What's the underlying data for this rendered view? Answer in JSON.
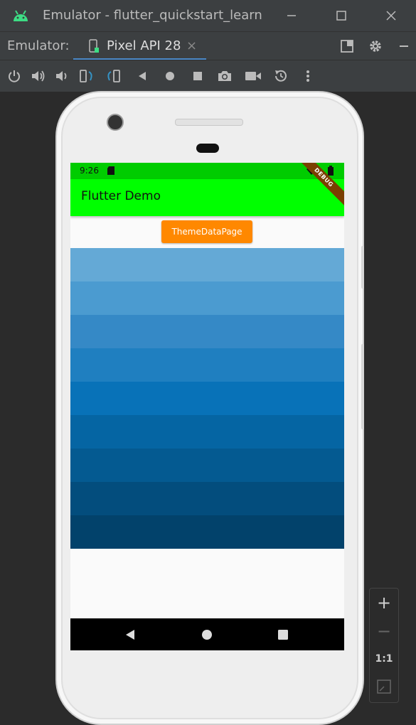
{
  "window": {
    "title": "Emulator - flutter_quickstart_learn"
  },
  "tabbar": {
    "label": "Emulator:",
    "tab_label": "Pixel API 28"
  },
  "colors": {
    "status_bar": "#00cc00",
    "app_bar": "#00ff00",
    "button": "#ff8800",
    "accent": "#4a88c7"
  },
  "toolbar": {
    "icons": [
      "power-icon",
      "volume-up-icon",
      "volume-down-icon",
      "rotate-left-icon",
      "rotate-right-icon",
      "back-icon",
      "home-icon",
      "overview-icon",
      "camera-icon",
      "video-icon",
      "snapshot-icon",
      "more-icon"
    ]
  },
  "device": {
    "status_time": "9:26",
    "debug_banner": "DEBUG",
    "app_title": "Flutter Demo",
    "button_label": "ThemeDataPage",
    "stripes": [
      "#64a9d6",
      "#4b9bd0",
      "#3589c6",
      "#1f7fc0",
      "#0872b8",
      "#0565a3",
      "#045a91",
      "#034d7d",
      "#02426b"
    ]
  },
  "zoom": {
    "plus": "+",
    "minus": "−",
    "ratio": "1:1"
  }
}
